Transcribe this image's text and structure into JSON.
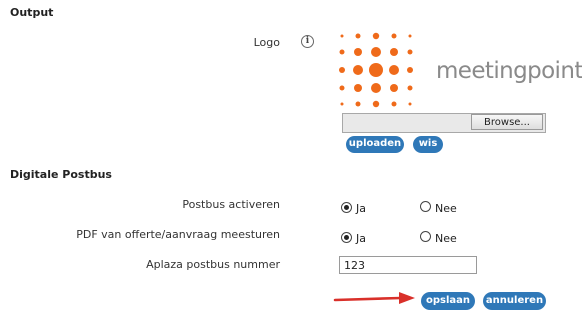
{
  "output": {
    "title": "Output",
    "logo_label": "Logo",
    "info_icon": "info-icon",
    "logo_brand_text": "meetingpoint",
    "browse_label": "Browse...",
    "upload_label": "uploaden",
    "clear_label": "wis"
  },
  "postbus": {
    "title": "Digitale Postbus",
    "activate_label": "Postbus activeren",
    "activate_options": [
      "Ja",
      "Nee"
    ],
    "activate_selected": "Ja",
    "pdf_label": "PDF van offerte/aanvraag meesturen",
    "pdf_options": [
      "Ja",
      "Nee"
    ],
    "pdf_selected": "Ja",
    "number_label": "Aplaza postbus nummer",
    "number_value": "123"
  },
  "actions": {
    "save_label": "opslaan",
    "cancel_label": "annuleren"
  },
  "colors": {
    "logo_orange": "#ef6a1a",
    "button_blue": "#2f78b8",
    "arrow_red": "#d9302a"
  }
}
